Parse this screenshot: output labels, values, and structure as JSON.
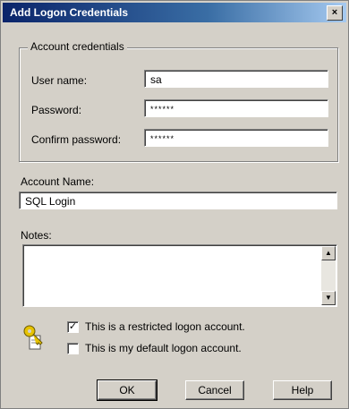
{
  "window": {
    "title": "Add Logon Credentials",
    "close_glyph": "×"
  },
  "account_credentials": {
    "group_label": "Account credentials",
    "user_name_label": "User name:",
    "user_name_value": "sa",
    "password_label": "Password:",
    "password_value": "******",
    "confirm_label": "Confirm password:",
    "confirm_value": "******"
  },
  "account_name": {
    "label": "Account Name:",
    "value": "SQL Login"
  },
  "notes": {
    "label": "Notes:",
    "value": "",
    "scroll_up": "▲",
    "scroll_down": "▼"
  },
  "options": {
    "restricted": {
      "label": "This is a restricted logon account.",
      "checked": true,
      "mark": "✓"
    },
    "default": {
      "label": "This is my default logon account.",
      "checked": false,
      "mark": ""
    }
  },
  "buttons": {
    "ok": "OK",
    "cancel": "Cancel",
    "help": "Help"
  },
  "icons": {
    "key": "key-icon"
  },
  "colors": {
    "titlebar_start": "#0a246a",
    "titlebar_end": "#a6caf0",
    "dialog": "#d4d0c8"
  }
}
